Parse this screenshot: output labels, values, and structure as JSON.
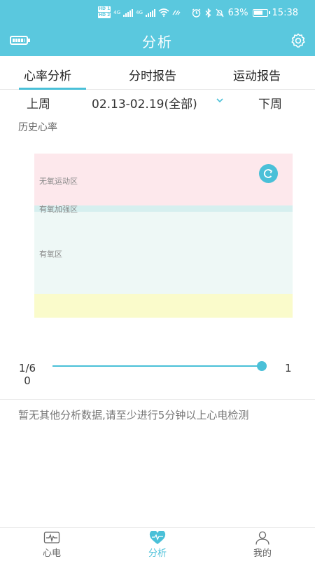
{
  "status_bar": {
    "hd1": "HD 1",
    "hd2": "HD 2",
    "net1": "4G",
    "net2": "4G",
    "battery_pct": "63%",
    "time": "15:38"
  },
  "app_bar": {
    "title": "分析"
  },
  "tabs": [
    {
      "label": "心率分析",
      "active": true
    },
    {
      "label": "分时报告",
      "active": false
    },
    {
      "label": "运动报告",
      "active": false
    }
  ],
  "week": {
    "prev_label": "上周",
    "range_label": "02.13-02.19(全部)",
    "next_label": "下周"
  },
  "history": {
    "label": "历史心率"
  },
  "zones": [
    {
      "label": "无氧运动区",
      "color": "#fde8ec"
    },
    {
      "label": "有氧加强区",
      "color": "#d6efef"
    },
    {
      "label": "有氧区",
      "color": "#eef8f6"
    },
    {
      "label": "",
      "color": "#fafbcb"
    }
  ],
  "slider": {
    "position_label": "1/6",
    "position_sub": "0",
    "max_label": "1",
    "value_fraction": 1.0
  },
  "notice": "暂无其他分析数据,请至少进行5分钟以上心电检测",
  "bottom_nav": [
    {
      "label": "心电",
      "icon": "ecg-icon",
      "active": false
    },
    {
      "label": "分析",
      "icon": "heart-icon",
      "active": true
    },
    {
      "label": "我的",
      "icon": "person-icon",
      "active": false
    }
  ],
  "colors": {
    "accent": "#5ac8de",
    "accent_dark": "#4ac0d8"
  }
}
